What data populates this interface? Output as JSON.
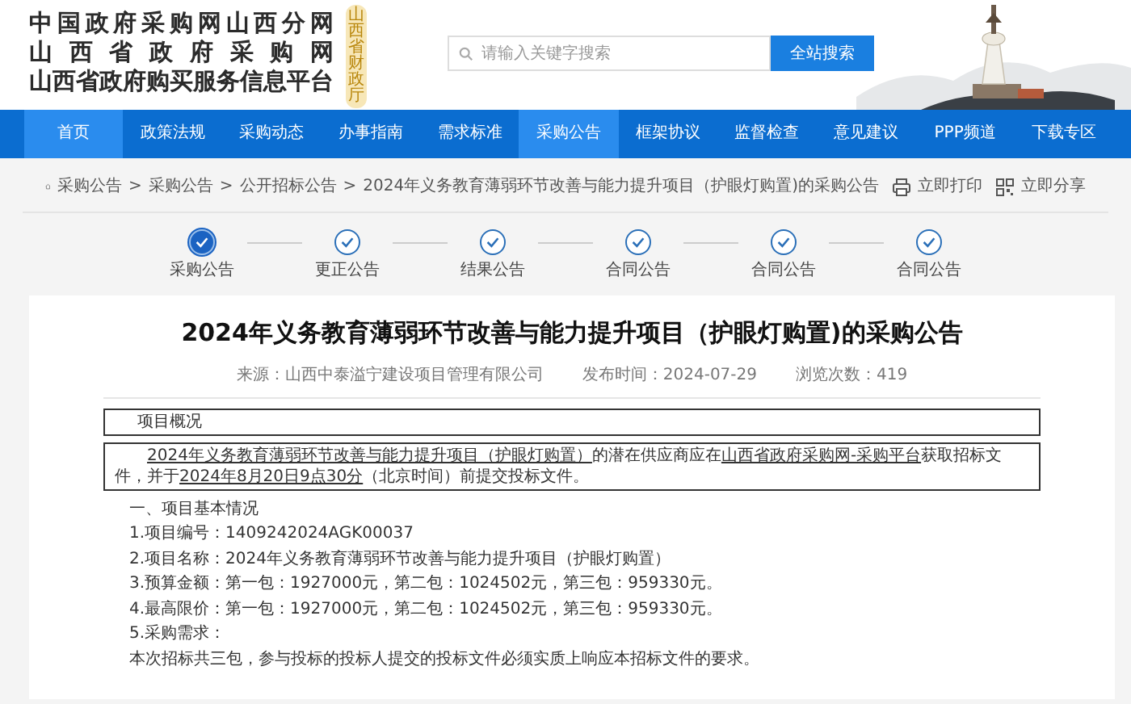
{
  "header": {
    "title_lines": [
      "中国政府采购网山西分网",
      "山西省政府采购网",
      "山西省政府购买服务信息平台"
    ],
    "seal": "山西省财政厅",
    "search": {
      "placeholder": "请输入关键字搜索"
    },
    "search_button": "全站搜索"
  },
  "nav": [
    {
      "label": "首页",
      "selected": true
    },
    {
      "label": "政策法规",
      "selected": false
    },
    {
      "label": "采购动态",
      "selected": false
    },
    {
      "label": "办事指南",
      "selected": false
    },
    {
      "label": "需求标准",
      "selected": false
    },
    {
      "label": "采购公告",
      "selected": true
    },
    {
      "label": "框架协议",
      "selected": false
    },
    {
      "label": "监督检查",
      "selected": false
    },
    {
      "label": "意见建议",
      "selected": false
    },
    {
      "label": "PPP频道",
      "selected": false
    },
    {
      "label": "下载专区",
      "selected": false
    }
  ],
  "breadcrumb": {
    "separator": ">",
    "items": [
      "采购公告",
      "采购公告",
      "公开招标公告",
      "2024年义务教育薄弱环节改善与能力提升项目（护眼灯购置)的采购公告"
    ]
  },
  "actions": [
    {
      "kind": "print",
      "label": "立即打印"
    },
    {
      "kind": "share",
      "label": "立即分享"
    }
  ],
  "steps": [
    {
      "label": "采购公告",
      "selected": true
    },
    {
      "label": "更正公告",
      "selected": false
    },
    {
      "label": "结果公告",
      "selected": false
    },
    {
      "label": "合同公告",
      "selected": false
    },
    {
      "label": "合同公告",
      "selected": false
    },
    {
      "label": "合同公告",
      "selected": false
    }
  ],
  "article": {
    "title": "2024年义务教育薄弱环节改善与能力提升项目（护眼灯购置)的采购公告",
    "meta": [
      "来源：山西中泰溢宁建设项目管理有限公司",
      "发布时间：2024-07-29",
      "浏览次数：419"
    ],
    "overview_heading": "项目概况",
    "overview": [
      {
        "text": "2024年义务教育薄弱环节改善与能力提升项目（护眼灯购置）",
        "link": true
      },
      {
        "text": "的潜在供应商应在",
        "link": false
      },
      {
        "text": "山西省政府采购网-采购平台",
        "link": true
      },
      {
        "text": "获取招标文件，并于",
        "link": false
      },
      {
        "text": "2024年8月20日9点30分",
        "link": true
      },
      {
        "text": "（北京时间）前提交投标文件。",
        "link": false
      }
    ],
    "lines": [
      "一、项目基本情况",
      "1.项目编号：1409242024AGK00037",
      "2.项目名称：2024年义务教育薄弱环节改善与能力提升项目（护眼灯购置）",
      "3.预算金额：第一包：1927000元，第二包：1024502元，第三包：959330元。",
      "4.最高限价：第一包：1927000元，第二包：1024502元，第三包：959330元。",
      "5.采购需求：",
      "本次招标共三包，参与投标的投标人提交的投标文件必须实质上响应本招标文件的要求。"
    ]
  }
}
